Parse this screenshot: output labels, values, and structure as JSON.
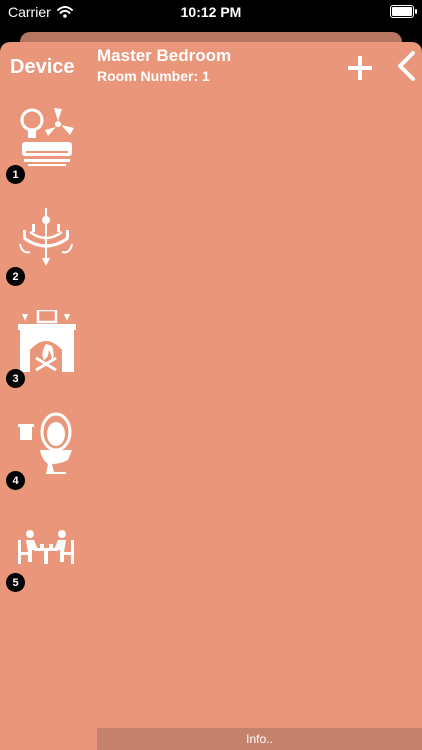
{
  "status": {
    "carrier": "Carrier",
    "time": "10:12 PM"
  },
  "header": {
    "device_label": "Device",
    "room_title": "Master Bedroom",
    "room_number": "Room Number: 1"
  },
  "devices": [
    {
      "number": "1",
      "icon": "light-fan-ac-icon"
    },
    {
      "number": "2",
      "icon": "chandelier-icon"
    },
    {
      "number": "3",
      "icon": "fireplace-icon"
    },
    {
      "number": "4",
      "icon": "toilet-icon"
    },
    {
      "number": "5",
      "icon": "dining-table-icon"
    }
  ],
  "footer": {
    "info_label": "Info.."
  },
  "colors": {
    "sheet": "#ea967a",
    "sheet_back": "#b77662",
    "info_bar": "#c4826c",
    "badge": "#000000"
  }
}
